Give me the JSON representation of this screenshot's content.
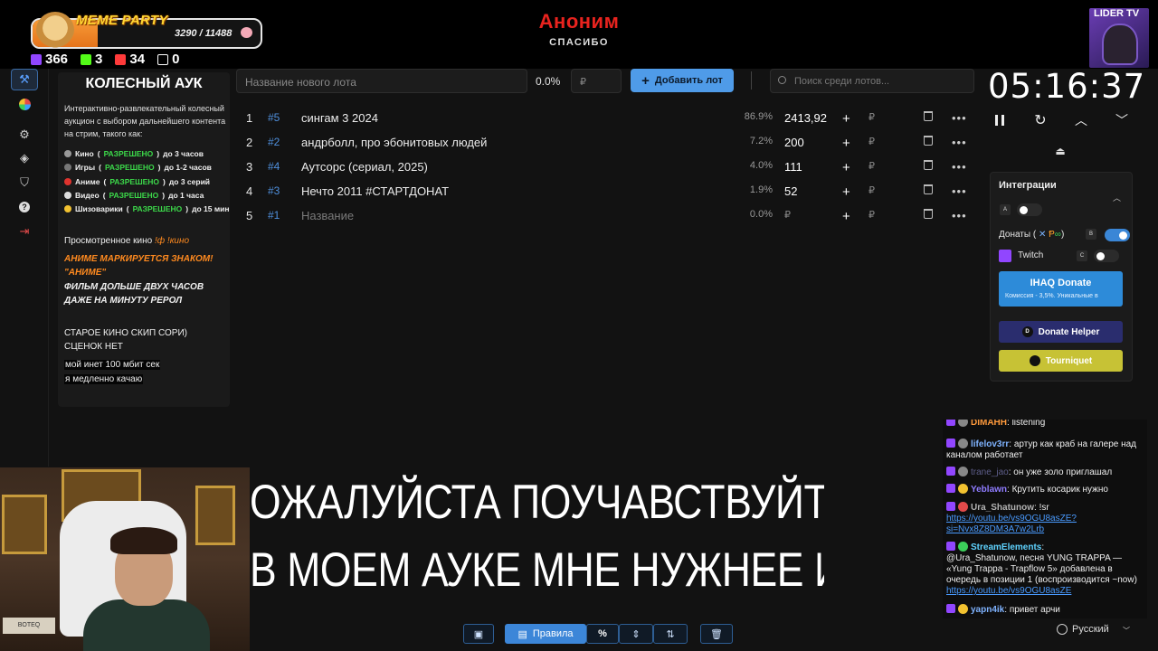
{
  "stream_overlay": {
    "meme_party_title": "MEME PARTY",
    "meme_party_progress": "3290 / 11488",
    "meme_party_fraction": 0.29,
    "stats": [
      {
        "icon": "twitch-icon",
        "value": "366",
        "color": "#9146ff"
      },
      {
        "icon": "kick-icon",
        "value": "3",
        "color": "#53fc18"
      },
      {
        "icon": "vk-live-icon",
        "value": "34",
        "color": "#ff3a3a"
      },
      {
        "icon": "w-icon",
        "value": "0",
        "color": "#ffffff"
      }
    ],
    "anon_title": "Аноним",
    "anon_subtitle": "СПАСИБО",
    "channel_badge": "LIDER TV",
    "overlay_line1": "ОЖАЛУЙСТА ПОУЧАВСТВУЙТЕ РЕБЯТА П",
    "overlay_line2": "В МОЕМ АУКЕ МНЕ НУЖНЕЕ      ИМЕННО I",
    "webcam_book": "BOTEQ"
  },
  "sidebar": {
    "items": [
      {
        "icon": "hammer-icon",
        "active": true
      },
      {
        "icon": "pie-chart-icon",
        "active": false
      },
      {
        "icon": "gear-icon",
        "active": false
      },
      {
        "icon": "layers-icon",
        "active": false
      },
      {
        "icon": "shield-icon",
        "active": false
      },
      {
        "icon": "help-icon",
        "active": false
      },
      {
        "icon": "logout-icon",
        "active": false
      }
    ]
  },
  "description": {
    "title": "КОЛЕСНЫЙ АУК",
    "intro": "Интерактивно-развлекательный колесный аукцион с выбором дальнейшего контента на стрим, такого как:",
    "rules": [
      {
        "icon": "film-icon",
        "name": "Кино",
        "status": "РАЗРЕШЕНО",
        "limit": "до 3 часов"
      },
      {
        "icon": "gamepad-icon",
        "name": "Игры",
        "status": "РАЗРЕШЕНО",
        "limit": "до 1-2 часов"
      },
      {
        "icon": "anime-icon",
        "name": "Аниме",
        "status": "РАЗРЕШЕНО",
        "limit": "до 3 серий"
      },
      {
        "icon": "video-icon",
        "name": "Видео",
        "status": "РАЗРЕШЕНО",
        "limit": "до 1 часа"
      },
      {
        "icon": "smile-icon",
        "name": "Шизоварики",
        "status": "РАЗРЕШЕНО",
        "limit": "до 15 мин"
      }
    ],
    "watched_label": "Просмотренное кино",
    "watched_cmd": "!ф !кино",
    "anime_note_1": "АНИМЕ МАРКИРУЕТСЯ ЗНАКОМ!",
    "anime_note_2": "\"АНИМЕ\"",
    "film_note_1": "ФИЛЬМ ДОЛЬШЕ ДВУХ ЧАСОВ",
    "film_note_2": "ДАЖЕ НА МИНУТУ РЕРОЛ",
    "old_note_1": "СТАРОЕ КИНО СКИП СОРИ)",
    "old_note_2": "СЦЕНОК НЕТ",
    "inet_note_1": "мой инет 100 мбит сек",
    "inet_note_2": "я медленно качаю"
  },
  "lot_form": {
    "name_placeholder": "Название нового лота",
    "percent": "0.0%",
    "price_placeholder": "₽",
    "add_label": "Добавить лот",
    "search_placeholder": "Поиск среди лотов..."
  },
  "lots": [
    {
      "index": "1",
      "num": "#5",
      "name": "сингам 3 2024",
      "percent": "86.9%",
      "amount": "2413,92",
      "placeholder": false
    },
    {
      "index": "2",
      "num": "#2",
      "name": "андрболл, про эбонитовых людей",
      "percent": "7.2%",
      "amount": "200",
      "placeholder": false
    },
    {
      "index": "3",
      "num": "#4",
      "name": "Аутсорс (сериал, 2025)",
      "percent": "4.0%",
      "amount": "111",
      "placeholder": false
    },
    {
      "index": "4",
      "num": "#3",
      "name": "Нечто 2011 #СТАРТДОНАТ",
      "percent": "1.9%",
      "amount": "52",
      "placeholder": false
    },
    {
      "index": "5",
      "num": "#1",
      "name": "Название",
      "percent": "0.0%",
      "amount": "₽",
      "placeholder": true
    }
  ],
  "lot_currency": "₽",
  "timer": {
    "value": "05:16:37"
  },
  "integrations": {
    "title": "Интеграции",
    "key_a": "A",
    "key_b": "B",
    "key_c": "C",
    "donations_label": "Донаты (",
    "donations_suffix": ")",
    "twitch_label": "Twitch",
    "ihaq_title": "IHAQ Donate",
    "ihaq_sub": "Комиссия - 3,5%. Уникальные в",
    "donate_helper": "Donate Helper",
    "tourniquet": "Tourniquet"
  },
  "chat": {
    "messages": [
      {
        "nick": "DIMAHH",
        "nick_color": "#ff9a3c",
        "text": "listening"
      },
      {
        "nick": "lifelov3rr",
        "nick_color": "#7fb3ff",
        "text": "артур как краб на галере над каналом работает"
      },
      {
        "nick": "trane_jao",
        "nick_color": "#5e5e8a",
        "text": "он уже золо приглашал"
      },
      {
        "nick": "Yeblawn",
        "nick_color": "#8f7cff",
        "text": "Крутить косарик нужно"
      },
      {
        "nick": "Ura_Shatunow",
        "nick_color": "#b3b3b3",
        "text": "!sr",
        "link": "https://youtu.be/vs9OGU8asZE?si=Nvx8Z8DM3A7w2Lrb"
      },
      {
        "nick": "StreamElements",
        "nick_color": "#5fd3ff",
        "text": "@Ura_Shatunow, песня YUNG TRAPPA — «Yung Trappa - Trapflow 5» добавлена в очередь в позиции 1 (воспроизводится ~now)",
        "link": "https://youtu.be/vs9OGU8asZE"
      },
      {
        "nick": "yapn4ik",
        "nick_color": "#7fb3ff",
        "text": "привет арчи"
      }
    ],
    "language": "Русский"
  },
  "toolbar": {
    "rules_label": "Правила",
    "percent_label": "%"
  }
}
